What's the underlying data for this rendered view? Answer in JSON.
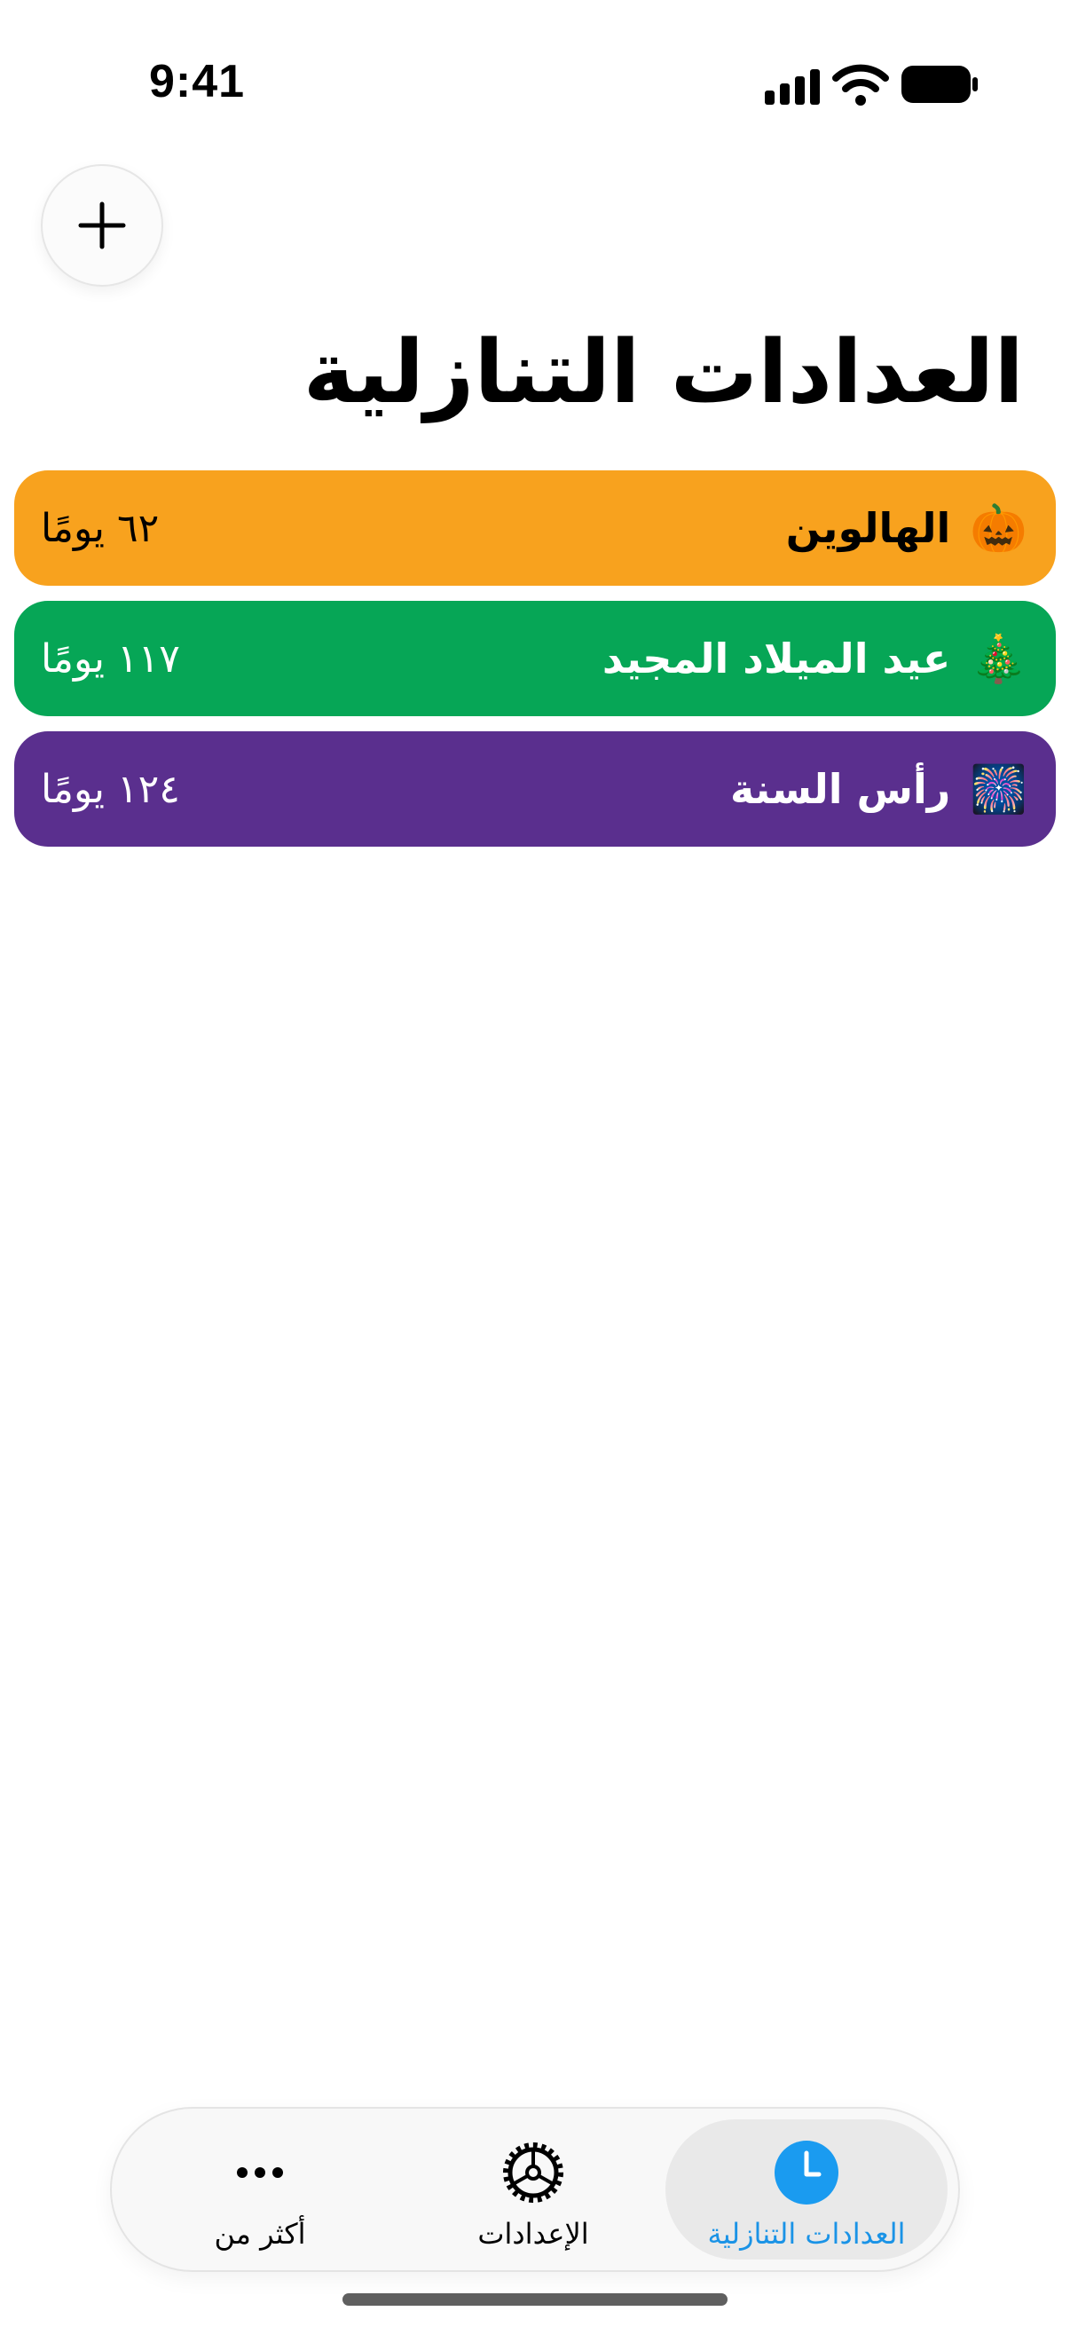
{
  "status_bar": {
    "time": "9:41"
  },
  "header": {
    "add_icon": "plus-icon",
    "title": "العدادات التنازلية"
  },
  "countdowns": [
    {
      "name": "الهالوين",
      "emoji": "🎃",
      "days": "٦٢ يومًا",
      "color": "#F8A21E"
    },
    {
      "name": "عيد الميلاد المجيد",
      "emoji": "🎄",
      "days": "١١٧ يومًا",
      "color": "#06A656"
    },
    {
      "name": "رأس السنة",
      "emoji": "🎆",
      "days": "١٢٤ يومًا",
      "color": "#5A2F8E"
    }
  ],
  "tab_bar": {
    "tabs": [
      {
        "label": "العدادات التنازلية",
        "icon": "clock-icon",
        "selected": true
      },
      {
        "label": "الإعدادات",
        "icon": "gear-icon",
        "selected": false
      },
      {
        "label": "أكثر من",
        "icon": "more-icon",
        "selected": false
      }
    ]
  },
  "colors": {
    "accent": "#1A9BF0"
  }
}
